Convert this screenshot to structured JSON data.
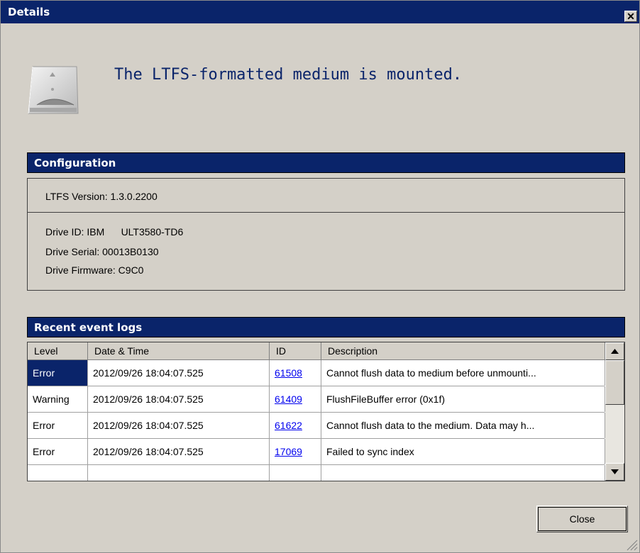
{
  "window": {
    "title": "Details"
  },
  "headline": "The LTFS-formatted medium is mounted.",
  "configuration": {
    "header": "Configuration",
    "ltfs_version": "LTFS Version: 1.3.0.2200",
    "drive_id": "Drive ID: IBM      ULT3580-TD6",
    "drive_serial": "Drive Serial: 00013B0130",
    "drive_firmware": "Drive Firmware: C9C0"
  },
  "logs": {
    "header": "Recent event logs",
    "columns": [
      "Level",
      "Date & Time",
      "ID",
      "Description"
    ],
    "rows": [
      {
        "level": "Error",
        "datetime": "2012/09/26 18:04:07.525",
        "id": "61508",
        "description": "Cannot flush data to medium before unmounti..."
      },
      {
        "level": "Warning",
        "datetime": "2012/09/26 18:04:07.525",
        "id": "61409",
        "description": "FlushFileBuffer error (0x1f)"
      },
      {
        "level": "Error",
        "datetime": "2012/09/26 18:04:07.525",
        "id": "61622",
        "description": "Cannot flush data to the medium. Data may h..."
      },
      {
        "level": "Error",
        "datetime": "2012/09/26 18:04:07.525",
        "id": "17069",
        "description": "Failed to sync index"
      }
    ],
    "selected_row": 0
  },
  "buttons": {
    "close": "Close"
  },
  "colors": {
    "titlebar": "#0a246a",
    "dialog_bg": "#d4d0c8",
    "link": "#0000ee",
    "headline": "#0a246a"
  }
}
